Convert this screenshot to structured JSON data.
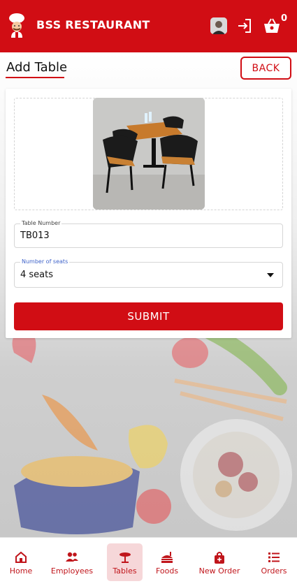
{
  "header": {
    "brand": "BSS RESTAURANT",
    "cart_count": "0",
    "logo_icon": "chef-icon",
    "logout_icon": "logout-icon",
    "cart_icon": "basket-icon",
    "color": "#d10d14"
  },
  "page": {
    "title": "Add Table",
    "back_label": "BACK"
  },
  "form": {
    "table_number": {
      "label": "Table Number",
      "value": "TB013"
    },
    "seats": {
      "label": "Number of seats",
      "value": "4 seats"
    },
    "submit_label": "SUBMIT"
  },
  "nav": {
    "items": [
      {
        "label": "Home",
        "icon": "home-icon"
      },
      {
        "label": "Employees",
        "icon": "people-icon"
      },
      {
        "label": "Tables",
        "icon": "table-icon",
        "active": true
      },
      {
        "label": "Foods",
        "icon": "food-icon"
      },
      {
        "label": "New Order",
        "icon": "bag-icon"
      },
      {
        "label": "Orders",
        "icon": "list-icon"
      }
    ]
  }
}
